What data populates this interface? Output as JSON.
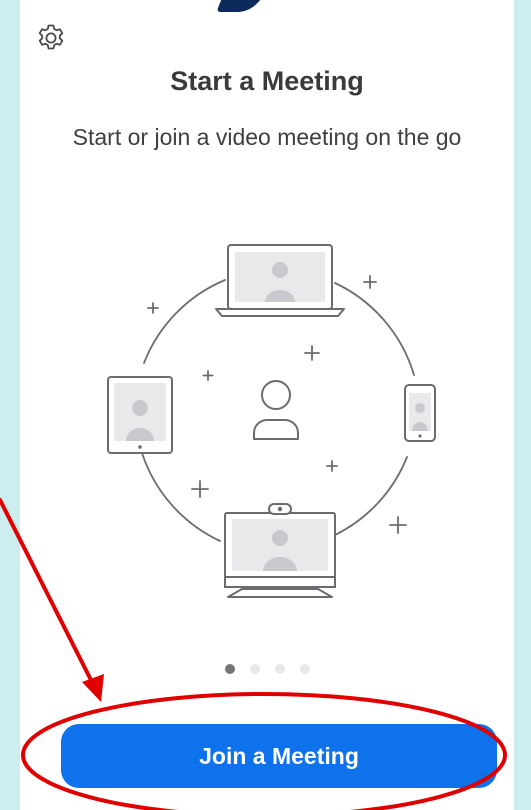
{
  "header": {
    "settings_icon": "gear-icon"
  },
  "onboarding": {
    "title": "Start a Meeting",
    "subtitle": "Start or join a video meeting on the go",
    "page_count": 4,
    "current_page": 1
  },
  "actions": {
    "join_label": "Join a Meeting"
  },
  "colors": {
    "background": "#cdeeee",
    "accent": "#0e72ed",
    "annotation": "#e00000",
    "illustration_line": "#6b6b70"
  }
}
